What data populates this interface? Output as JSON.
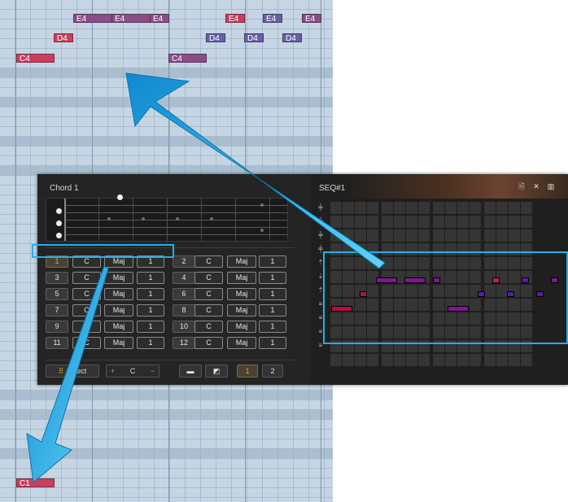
{
  "piano_roll": {
    "notes": [
      {
        "label": "E4",
        "color": "#8a4d86"
      },
      {
        "label": "E4",
        "color": "#8a4d86"
      },
      {
        "label": "E4",
        "color": "#8a4d86"
      },
      {
        "label": "E4",
        "color": "#c8405e"
      },
      {
        "label": "E4",
        "color": "#6660a6"
      },
      {
        "label": "E4",
        "color": "#8a4d86"
      },
      {
        "label": "D4",
        "color": "#c8405e"
      },
      {
        "label": "D4",
        "color": "#6660a6"
      },
      {
        "label": "D4",
        "color": "#6660a6"
      },
      {
        "label": "D4",
        "color": "#6660a6"
      },
      {
        "label": "C4",
        "color": "#c8405e"
      },
      {
        "label": "C4",
        "color": "#8a4d86"
      },
      {
        "label": "C1",
        "color": "#c8405e"
      }
    ]
  },
  "chord_panel": {
    "title": "Chord 1",
    "rows": [
      {
        "left": {
          "index": "1",
          "root": "C",
          "quality": "Maj",
          "inversion": "1"
        },
        "right": {
          "index": "2",
          "root": "C",
          "quality": "Maj",
          "inversion": "1"
        }
      },
      {
        "left": {
          "index": "3",
          "root": "C",
          "quality": "Maj",
          "inversion": "1"
        },
        "right": {
          "index": "4",
          "root": "C",
          "quality": "Maj",
          "inversion": "1"
        }
      },
      {
        "left": {
          "index": "5",
          "root": "C",
          "quality": "Maj",
          "inversion": "1"
        },
        "right": {
          "index": "6",
          "root": "C",
          "quality": "Maj",
          "inversion": "1"
        }
      },
      {
        "left": {
          "index": "7",
          "root": "C",
          "quality": "Maj",
          "inversion": "1"
        },
        "right": {
          "index": "8",
          "root": "C",
          "quality": "Maj",
          "inversion": "1"
        }
      },
      {
        "left": {
          "index": "9",
          "root": "C",
          "quality": "Maj",
          "inversion": "1"
        },
        "right": {
          "index": "10",
          "root": "C",
          "quality": "Maj",
          "inversion": "1"
        }
      },
      {
        "left": {
          "index": "11",
          "root": "C",
          "quality": "Maj",
          "inversion": "1"
        },
        "right": {
          "index": "12",
          "root": "C",
          "quality": "Maj",
          "inversion": "1"
        }
      }
    ],
    "active_chord": "1",
    "toolbar": {
      "select_label": "Select",
      "key_plus": "+",
      "key_value": "C",
      "key_minus": "−",
      "page_1": "1",
      "page_2": "2",
      "active_page": "1"
    }
  },
  "seq_panel": {
    "title": "SEQ#1",
    "header_icons": [
      "save-icon",
      "close-icon",
      "bars-icon"
    ],
    "row_icons": [
      "arp-icon",
      "arp-icon",
      "arp-icon",
      "arp-icon",
      "up-arrow-icon",
      "down-arrow-icon",
      "up-arrow-icon",
      "lines-icon",
      "lines-icon",
      "lines-icon",
      "lines-icon"
    ],
    "colors": {
      "accent": "#21b0e8",
      "note_red": "#c21f5a",
      "note_purple": "#7a1a8a",
      "note_violet": "#5a1ab0"
    }
  },
  "glyphs": {
    "save": "🗎",
    "close": "✕",
    "bars": "▥",
    "folder": "▬",
    "export": "◩",
    "select": "⠿",
    "arp": "╪",
    "up": "⇡",
    "down": "⇣",
    "lines": "≡"
  }
}
